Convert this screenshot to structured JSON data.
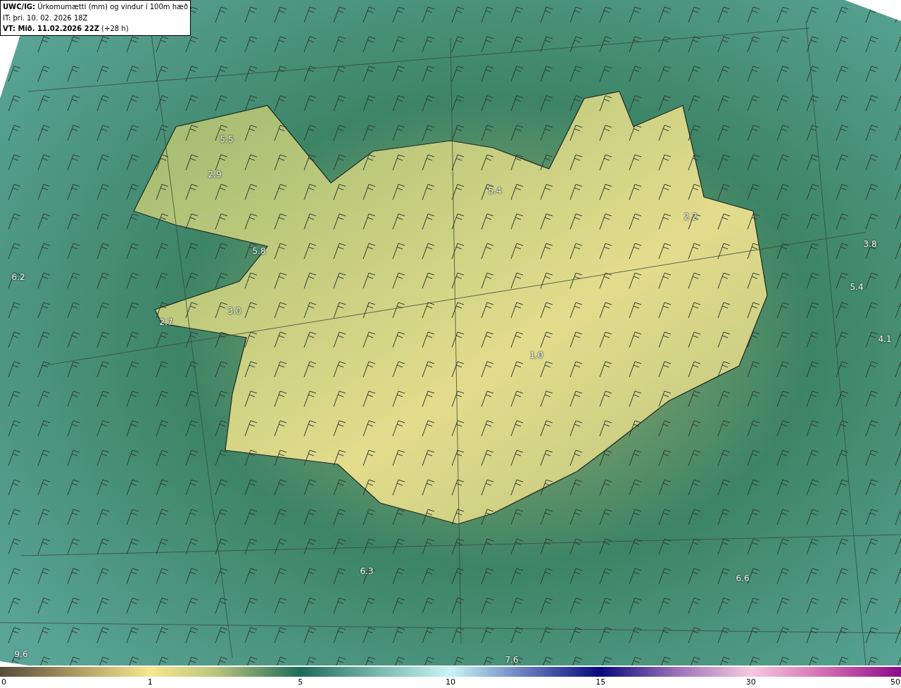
{
  "header": {
    "lines": [
      "**UWC/IG:** Úrkomumætti (mm) og vindur í 100m hæð",
      "IT: þri. 10. 02. 2026 18Z",
      "**VT: Mið. 11.02.2026 22Z** (+28 h)"
    ]
  },
  "map": {
    "value_labels": [
      "5.5",
      "2.9",
      "5.8",
      "6.2",
      "3.0",
      "2.7",
      "5.4",
      "2.2",
      "3.8",
      "5.4",
      "4.1",
      "1.0",
      "6.3",
      "6.6",
      "9.6",
      "7.6"
    ]
  },
  "colorbar": {
    "ticks": [
      "0",
      "1",
      "5",
      "10",
      "15",
      "30",
      "50"
    ]
  }
}
